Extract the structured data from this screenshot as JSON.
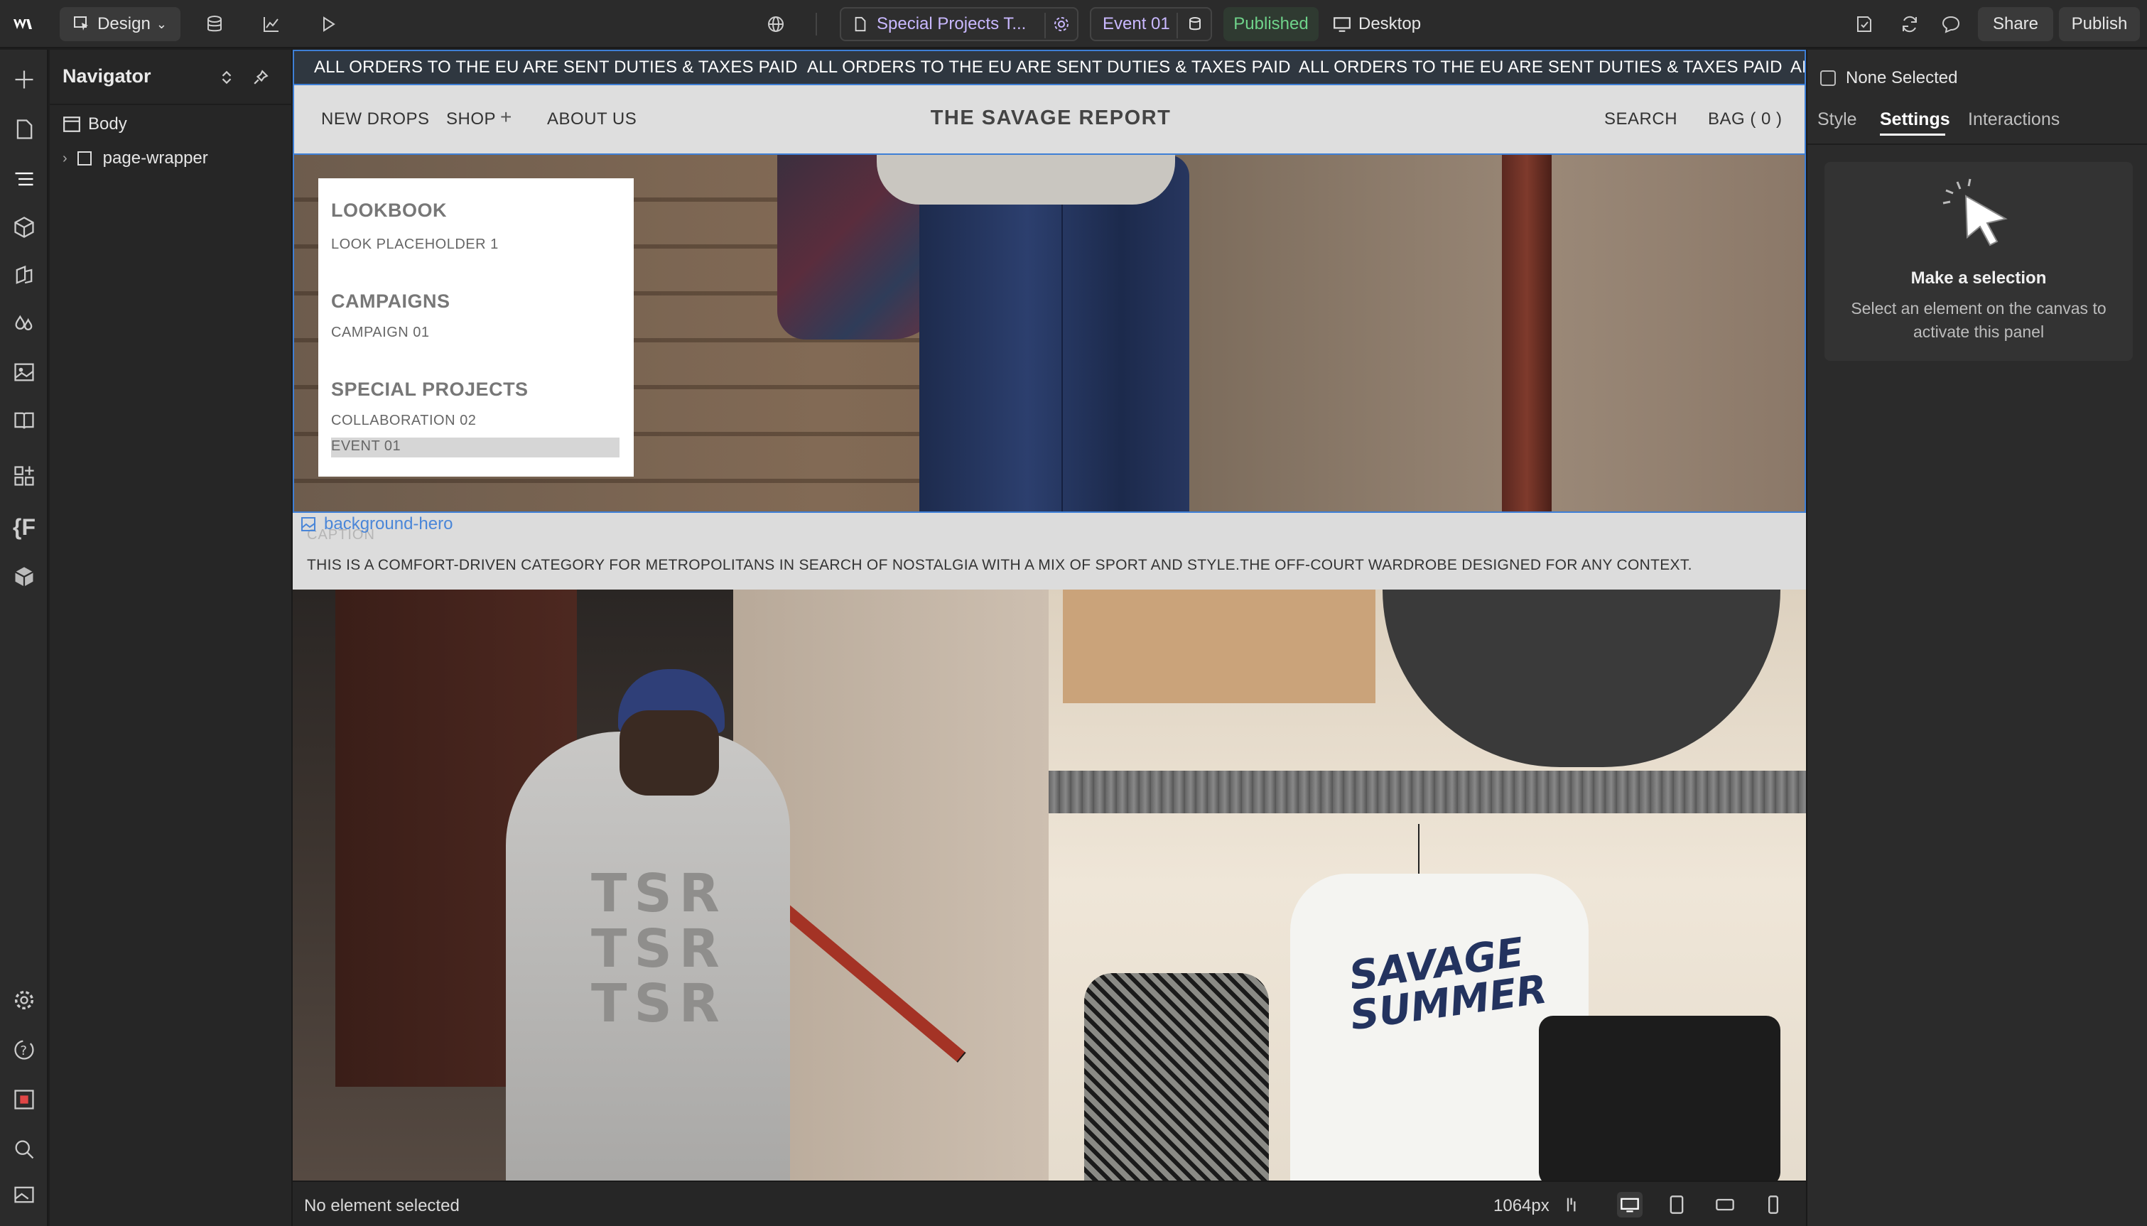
{
  "topbar": {
    "mode_label": "Design",
    "page_name": "Special Projects T...",
    "event_label": "Event 01",
    "status_label": "Published",
    "device_label": "Desktop",
    "share_label": "Share",
    "publish_label": "Publish"
  },
  "navigator": {
    "title": "Navigator",
    "tree": [
      {
        "label": "Body"
      },
      {
        "label": "page-wrapper"
      }
    ]
  },
  "site": {
    "marquee": [
      "ALL ORDERS TO THE EU ARE SENT DUTIES & TAXES PAID",
      "ALL ORDERS TO THE EU ARE SENT DUTIES & TAXES PAID",
      "ALL ORDERS TO THE EU ARE SENT DUTIES & TAXES PAID",
      "AL"
    ],
    "nav": {
      "new_drops": "NEW DROPS",
      "shop": "SHOP",
      "about": "ABOUT US",
      "brand": "THE SAVAGE REPORT",
      "search": "SEARCH",
      "bag": "BAG ( 0 )"
    },
    "dropdown": {
      "lookbook_heading": "LOOKBOOK",
      "lookbook_item": "LOOK PLACEHOLDER 1",
      "campaigns_heading": "CAMPAIGNS",
      "campaigns_item": "CAMPAIGN 01",
      "special_heading": "SPECIAL PROJECTS",
      "special_item_1": "COLLABORATION 02",
      "special_item_2": "EVENT 01"
    },
    "element_label": "background-hero",
    "caption_ghost": "CAPTION",
    "caption_text": "THIS IS A COMFORT-DRIVEN CATEGORY FOR METROPOLITANS IN SEARCH OF NOSTALGIA WITH A MIX OF SPORT AND STYLE.THE OFF-COURT WARDROBE DESIGNED FOR ANY CONTEXT.",
    "photo_left_print": "TSR\nTSR\nTSR",
    "photo_right_print": "SAVAGE\nSUMMER"
  },
  "bottombar": {
    "status": "No element selected",
    "width_readout": "1064px"
  },
  "rightpanel": {
    "selection_label": "None Selected",
    "tabs": [
      "Style",
      "Settings",
      "Interactions"
    ],
    "active_tab": "Settings",
    "card_title": "Make a selection",
    "card_text": "Select an element on the canvas to activate this panel"
  },
  "colors": {
    "accent": "#3e7fd6",
    "published": "#6fd38a",
    "chrome": "#2b2b2b"
  }
}
